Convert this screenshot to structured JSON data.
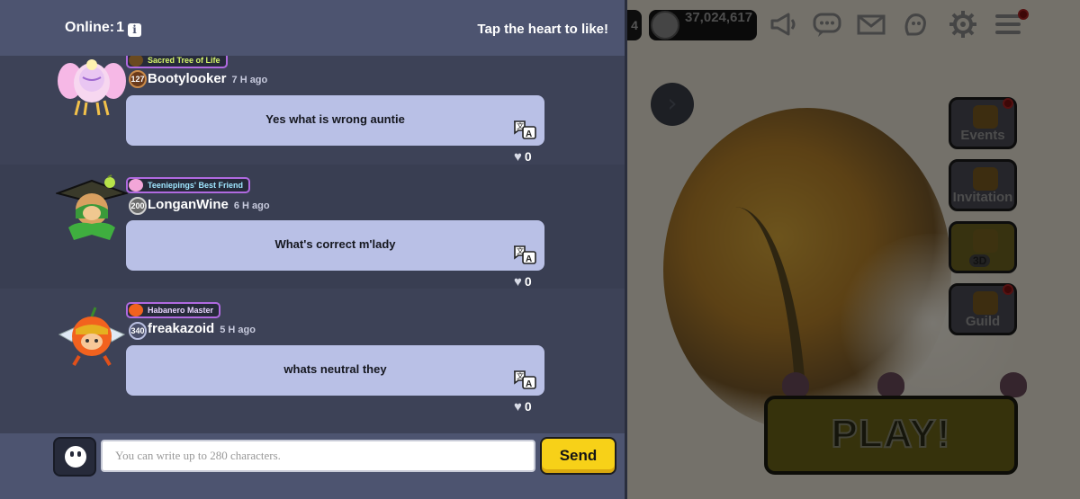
{
  "chat": {
    "online_label": "Online:",
    "online_count": "1",
    "hint": "Tap the heart to like!",
    "messages": [
      {
        "title": "Sacred Tree of Life",
        "title_color": "#8dc63f",
        "level": "127",
        "username": "Bootylooker",
        "time": "7 H ago",
        "text": "Yes what is wrong auntie",
        "likes": "0"
      },
      {
        "title": "Teeniepings' Best Friend",
        "title_color": "#7cc8e8",
        "level": "200",
        "username": "LonganWine",
        "time": "6 H ago",
        "text": "What's correct m'lady",
        "likes": "0"
      },
      {
        "title": "Habanero Master",
        "title_color": "#c9a0ff",
        "level": "340",
        "username": "freakazoid",
        "time": "5 H ago",
        "text": "whats neutral they",
        "likes": "0"
      }
    ],
    "input_placeholder": "You can write up to 280 characters.",
    "send_label": "Send"
  },
  "game": {
    "currency_partial": "4",
    "coins": "37,024,617",
    "icons": [
      "megaphone-icon",
      "chat-bubble-icon",
      "mail-icon",
      "friends-icon",
      "gear-icon",
      "menu-icon"
    ],
    "side_buttons": [
      {
        "label": "Events",
        "icon": "gift-icon"
      },
      {
        "label": "Invitation",
        "icon": "letter-icon"
      },
      {
        "label": "3D",
        "icon": "cookie-run-icon"
      },
      {
        "label": "Guild",
        "icon": "shield-icon"
      }
    ],
    "play_label": "PLAY!"
  },
  "colors": {
    "panel_bg": "#3d4257",
    "header_bg": "#4d5470",
    "bubble_bg": "#b9c0e6",
    "send_yellow": "#f7d118"
  }
}
